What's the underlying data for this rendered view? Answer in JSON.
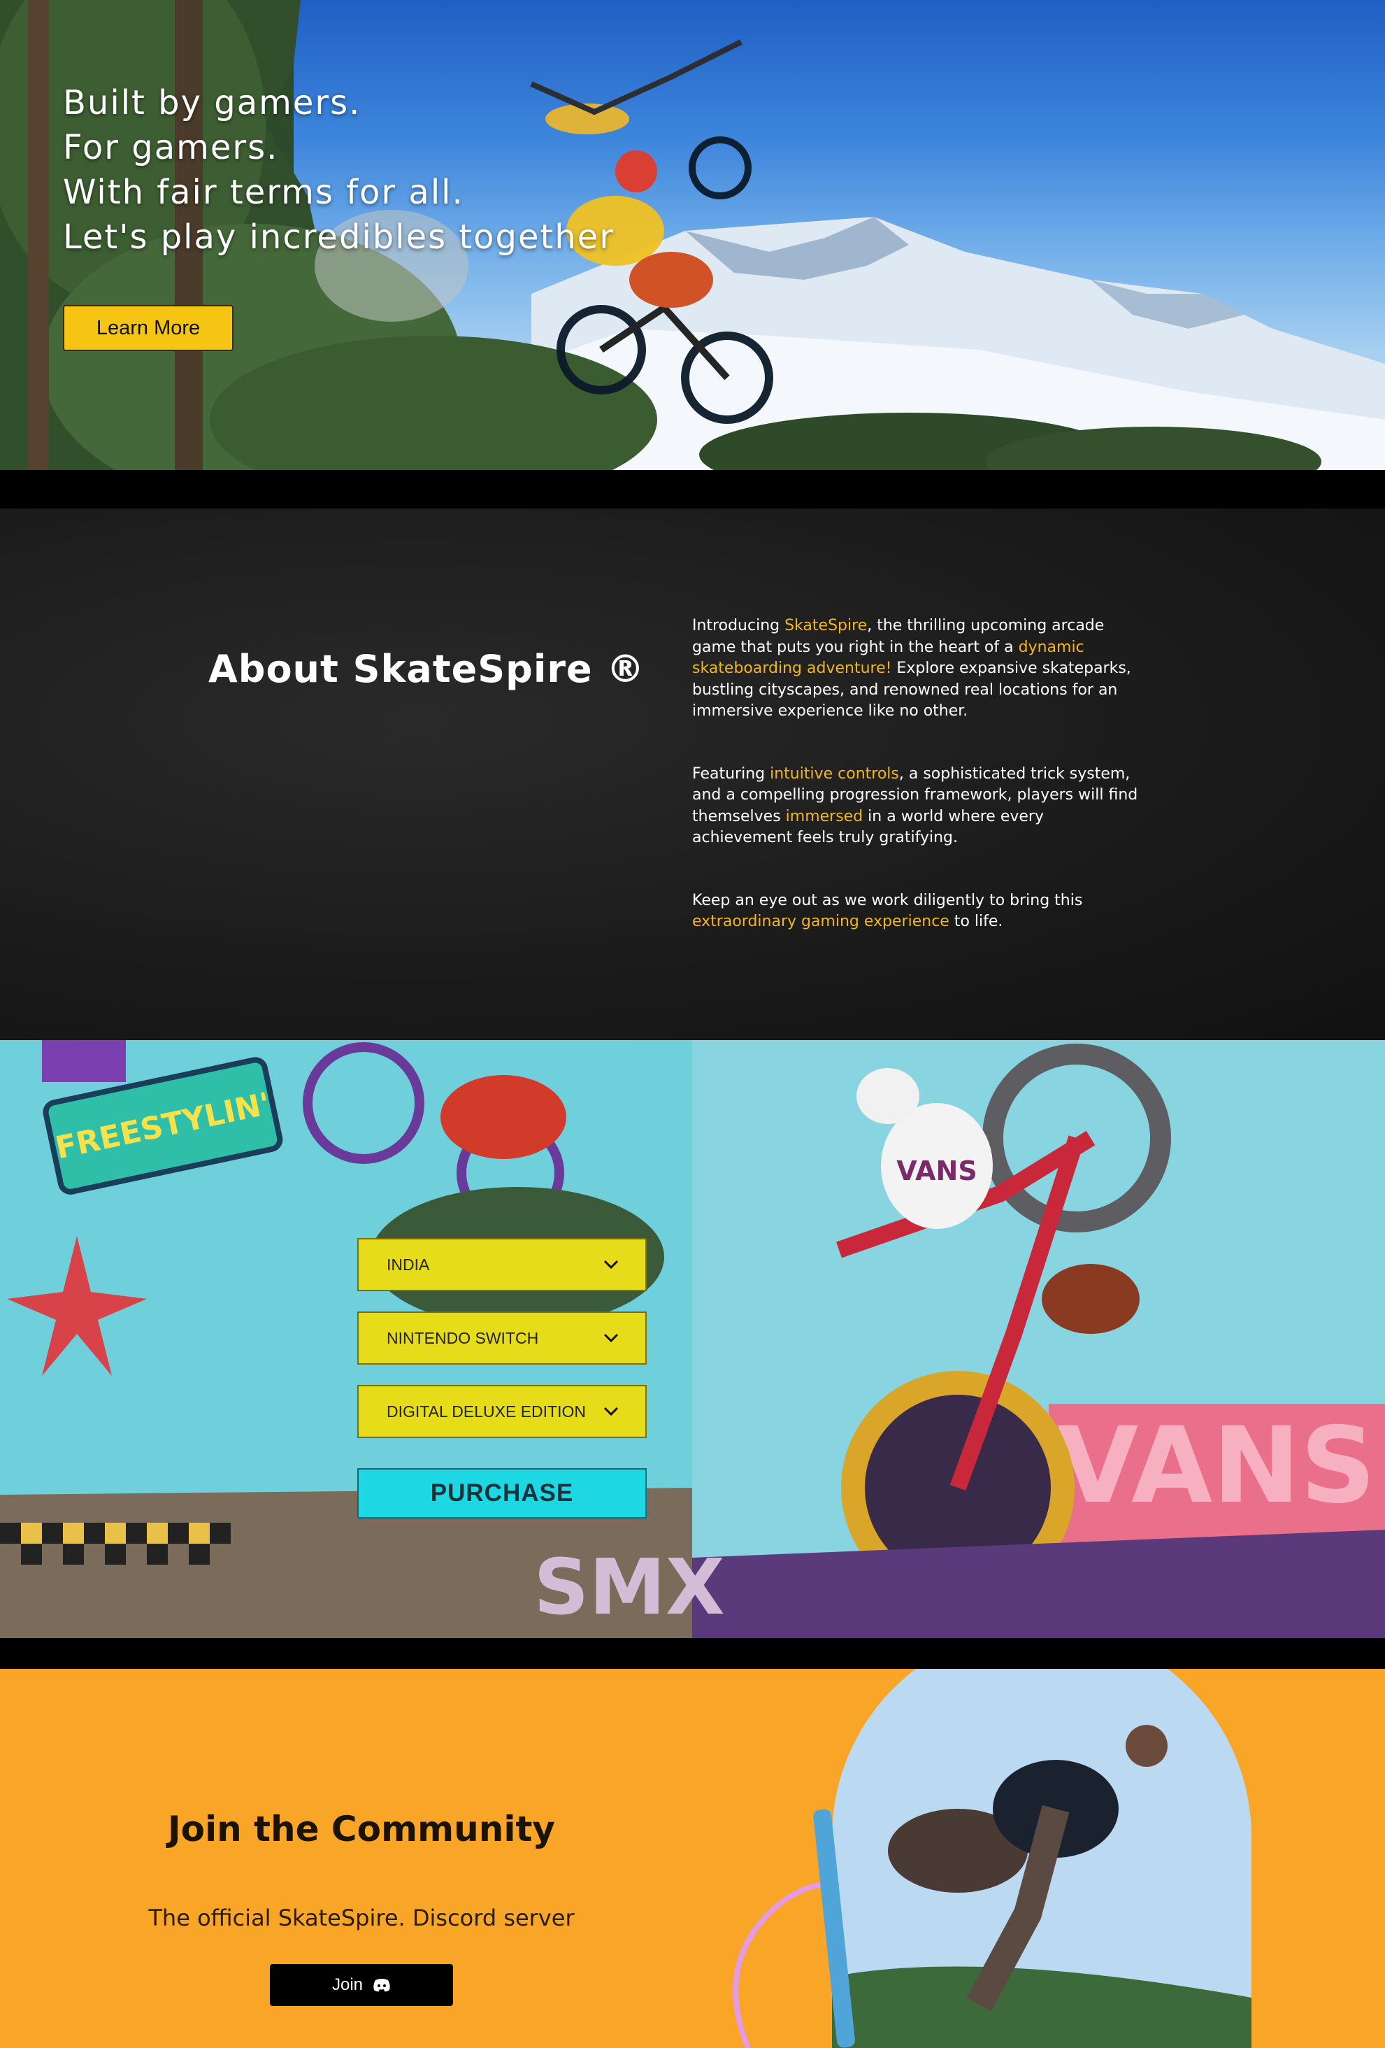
{
  "hero": {
    "lines": [
      "Built by gamers.",
      "For gamers.",
      "With fair terms for all.",
      "Let's play incredibles together"
    ],
    "learn_more_label": "Learn More"
  },
  "about": {
    "title": "About SkateSpire ®",
    "p1": {
      "a": "Introducing ",
      "b": "SkateSpire",
      "c": ", the thrilling upcoming arcade game that puts you right in the heart of a ",
      "d": "dynamic skateboarding adventure!",
      "e": " Explore expansive skateparks, bustling cityscapes, and renowned real locations for an immersive experience like no other."
    },
    "p2": {
      "a": "Featuring ",
      "b": "intuitive controls",
      "c": ", a sophisticated trick system, and a compelling progression framework, players will find themselves ",
      "d": "immersed",
      "e": " in a world where every achievement feels truly gratifying."
    },
    "p3": {
      "a": "Keep an eye out as we work diligently to bring this ",
      "b": "extraordinary gaming experience",
      "c": " to life."
    }
  },
  "purchase": {
    "region": "INDIA",
    "platform": "NINTENDO SWITCH",
    "edition": "DIGITAL DELUXE EDITION",
    "button_label": "PURCHASE",
    "art_texts": {
      "sign": "FREESTYLIN'",
      "wall": "VANS",
      "shirt": "VANS",
      "ramp": "SMX"
    }
  },
  "community": {
    "title": "Join the Community",
    "subtitle": "The official SkateSpire. Discord server",
    "join_label": "Join"
  },
  "colors": {
    "accent_yellow": "#f6c513",
    "highlight": "#f3b61a",
    "purchase_cyan": "#1dd7e3",
    "select_yellow": "#e6dc1a",
    "community_orange": "#f9a528"
  },
  "icons": {
    "chevron": "chevron-down-icon",
    "discord": "discord-icon"
  }
}
